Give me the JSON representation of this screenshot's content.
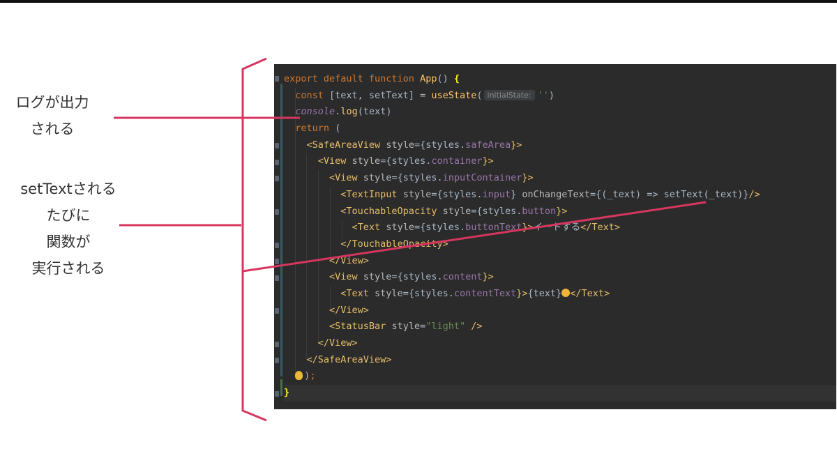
{
  "annotations": {
    "log_note": [
      "ログが出力",
      "される"
    ],
    "settext_note": [
      "setTextされる",
      "たびに",
      "関数が",
      "実行される"
    ]
  },
  "editor": {
    "hint_label": "initialState:",
    "lines": [
      [
        {
          "t": "export default function ",
          "c": "kw"
        },
        {
          "t": "App",
          "c": "fn"
        },
        {
          "t": "() ",
          "c": ""
        },
        {
          "t": "{",
          "c": "brace-hl"
        }
      ],
      [
        {
          "t": "  const ",
          "c": "kw"
        },
        {
          "t": "[text, setText] = ",
          "c": ""
        },
        {
          "t": "useState",
          "c": "fn"
        },
        {
          "t": "(",
          "c": ""
        },
        {
          "t": "initialState:",
          "c": "hint"
        },
        {
          "t": "''",
          "c": "str"
        },
        {
          "t": ")",
          "c": ""
        }
      ],
      [
        {
          "t": "  ",
          "c": ""
        },
        {
          "t": "console",
          "c": "con"
        },
        {
          "t": ".",
          "c": ""
        },
        {
          "t": "log",
          "c": "fn"
        },
        {
          "t": "(text)",
          "c": ""
        }
      ],
      [
        {
          "t": "  return ",
          "c": "kw"
        },
        {
          "t": "(",
          "c": ""
        }
      ],
      [
        {
          "t": "    <",
          "c": "tag"
        },
        {
          "t": "SafeAreaView ",
          "c": "tag"
        },
        {
          "t": "style",
          "c": "attr"
        },
        {
          "t": "={styles.",
          "c": ""
        },
        {
          "t": "safeArea",
          "c": "prop"
        },
        {
          "t": "}>",
          "c": "tag"
        }
      ],
      [
        {
          "t": "      <",
          "c": "tag"
        },
        {
          "t": "View ",
          "c": "tag"
        },
        {
          "t": "style",
          "c": "attr"
        },
        {
          "t": "={styles.",
          "c": ""
        },
        {
          "t": "container",
          "c": "prop"
        },
        {
          "t": "}>",
          "c": "tag"
        }
      ],
      [
        {
          "t": "        <",
          "c": "tag"
        },
        {
          "t": "View ",
          "c": "tag"
        },
        {
          "t": "style",
          "c": "attr"
        },
        {
          "t": "={styles.",
          "c": ""
        },
        {
          "t": "inputContainer",
          "c": "prop"
        },
        {
          "t": "}>",
          "c": "tag"
        }
      ],
      [
        {
          "t": "          <",
          "c": "tag"
        },
        {
          "t": "TextInput ",
          "c": "tag"
        },
        {
          "t": "style",
          "c": "attr"
        },
        {
          "t": "={styles.",
          "c": ""
        },
        {
          "t": "input",
          "c": "prop"
        },
        {
          "t": "} ",
          "c": ""
        },
        {
          "t": "onChangeText",
          "c": "attr"
        },
        {
          "t": "={(_text) => setText(_text)}",
          "c": ""
        },
        {
          "t": "/>",
          "c": "tag"
        }
      ],
      [
        {
          "t": "          <",
          "c": "tag"
        },
        {
          "t": "TouchableOpacity ",
          "c": "tag"
        },
        {
          "t": "style",
          "c": "attr"
        },
        {
          "t": "={styles.",
          "c": ""
        },
        {
          "t": "button",
          "c": "prop"
        },
        {
          "t": "}>",
          "c": "tag"
        }
      ],
      [
        {
          "t": "            <",
          "c": "tag"
        },
        {
          "t": "Text ",
          "c": "tag"
        },
        {
          "t": "style",
          "c": "attr"
        },
        {
          "t": "={styles.",
          "c": ""
        },
        {
          "t": "buttonText",
          "c": "prop"
        },
        {
          "t": "}>",
          "c": "tag"
        },
        {
          "t": "イートする",
          "c": ""
        },
        {
          "t": "</Text>",
          "c": "tag"
        }
      ],
      [
        {
          "t": "          </",
          "c": "tag"
        },
        {
          "t": "TouchableOpacity",
          "c": "tag"
        },
        {
          "t": ">",
          "c": "tag"
        }
      ],
      [
        {
          "t": "        </",
          "c": "tag"
        },
        {
          "t": "View",
          "c": "tag"
        },
        {
          "t": ">",
          "c": "tag"
        }
      ],
      [
        {
          "t": "        <",
          "c": "tag"
        },
        {
          "t": "View ",
          "c": "tag"
        },
        {
          "t": "style",
          "c": "attr"
        },
        {
          "t": "={styles.",
          "c": ""
        },
        {
          "t": "content",
          "c": "prop"
        },
        {
          "t": "}>",
          "c": "tag"
        }
      ],
      [
        {
          "t": "          <",
          "c": "tag"
        },
        {
          "t": "Text ",
          "c": "tag"
        },
        {
          "t": "style",
          "c": "attr"
        },
        {
          "t": "={styles.",
          "c": ""
        },
        {
          "t": "contentText",
          "c": "prop"
        },
        {
          "t": "}>",
          "c": "tag"
        },
        {
          "t": "{text}",
          "c": ""
        },
        {
          "t": "emoji",
          "c": "emoji"
        },
        {
          "t": "</Text>",
          "c": "tag"
        }
      ],
      [
        {
          "t": "        </",
          "c": "tag"
        },
        {
          "t": "View",
          "c": "tag"
        },
        {
          "t": ">",
          "c": "tag"
        }
      ],
      [
        {
          "t": "        <",
          "c": "tag"
        },
        {
          "t": "StatusBar ",
          "c": "tag"
        },
        {
          "t": "style",
          "c": "attr"
        },
        {
          "t": "=",
          "c": ""
        },
        {
          "t": "\"light\"",
          "c": "str"
        },
        {
          "t": " />",
          "c": "tag"
        }
      ],
      [
        {
          "t": "      </",
          "c": "tag"
        },
        {
          "t": "View",
          "c": "tag"
        },
        {
          "t": ">",
          "c": "tag"
        }
      ],
      [
        {
          "t": "    </",
          "c": "tag"
        },
        {
          "t": "SafeAreaView",
          "c": "tag"
        },
        {
          "t": ">",
          "c": "tag"
        }
      ],
      [
        {
          "t": "  ",
          "c": ""
        },
        {
          "t": "bulb",
          "c": "bulb"
        },
        {
          "t": ")",
          "c": ""
        },
        {
          "t": ";",
          "c": "kw"
        }
      ],
      [
        {
          "t": "}",
          "c": "brace-hl"
        }
      ]
    ]
  },
  "colors": {
    "accent_red": "#d6365f",
    "editor_bg": "#2b2b2b"
  }
}
